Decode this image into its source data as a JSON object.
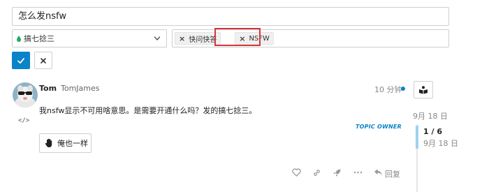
{
  "composer": {
    "title_value": "怎么发nsfw",
    "category": {
      "label": "搞七捻三",
      "color": "#25aa60"
    },
    "tags": [
      "快问快答",
      "NSFW"
    ],
    "highlight_color": "#d9343c",
    "save_icon": "check-icon",
    "cancel_icon": "close-icon"
  },
  "post": {
    "author_name": "Tom",
    "author_username": "TomJames",
    "time": "10 分钟",
    "body": "我nsfw显示不可用啥意思。是需要开通什么吗？发的搞七捻三。",
    "code_icon": "</>",
    "topic_owner": "TOPIC OWNER",
    "like_label": "俺也一样",
    "actions": [
      "heart-icon",
      "link-icon",
      "rocket-icon",
      "more-icon",
      "reply-icon"
    ],
    "reply_label": "回复",
    "accent_color": "#0a83c9"
  },
  "timeline": {
    "date_top": "9月 18 日",
    "count": "1 / 6",
    "date_bottom": "9月 18 日"
  }
}
